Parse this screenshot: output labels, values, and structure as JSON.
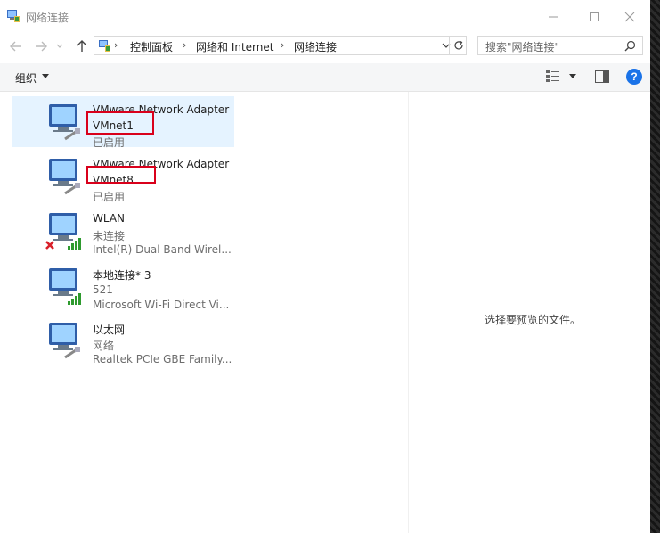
{
  "window": {
    "title": "网络连接",
    "controls": {
      "minimize": "minimize-icon",
      "maximize": "maximize-icon",
      "close": "close-icon"
    }
  },
  "address": {
    "crumbs": [
      "控制面板",
      "网络和 Internet",
      "网络连接"
    ],
    "search_placeholder": "搜索\"网络连接\""
  },
  "toolbar": {
    "organize_label": "组织"
  },
  "connections": [
    {
      "name": "VMware Network Adapter",
      "name2": "VMnet1",
      "status": "已启用",
      "device": "",
      "selected": true,
      "signal": false,
      "disconnected": false
    },
    {
      "name": "VMware Network Adapter",
      "name2": "VMnet8",
      "status": "已启用",
      "device": "",
      "selected": false,
      "signal": false,
      "disconnected": false
    },
    {
      "name": "WLAN",
      "name2": "",
      "status": "未连接",
      "device": "Intel(R) Dual Band Wirel...",
      "selected": false,
      "signal": true,
      "disconnected": true
    },
    {
      "name": "本地连接* 3",
      "name2": "",
      "status": "521",
      "device": "Microsoft Wi-Fi Direct Vi...",
      "selected": false,
      "signal": true,
      "disconnected": false
    },
    {
      "name": "以太网",
      "name2": "",
      "status": "网络",
      "device": "Realtek PCIe GBE Family...",
      "selected": false,
      "signal": false,
      "disconnected": false
    }
  ],
  "preview": {
    "message": "选择要预览的文件。"
  },
  "colors": {
    "selection": "#e5f3ff",
    "highlight_box": "#d9001b",
    "help_button": "#1a73e8"
  }
}
